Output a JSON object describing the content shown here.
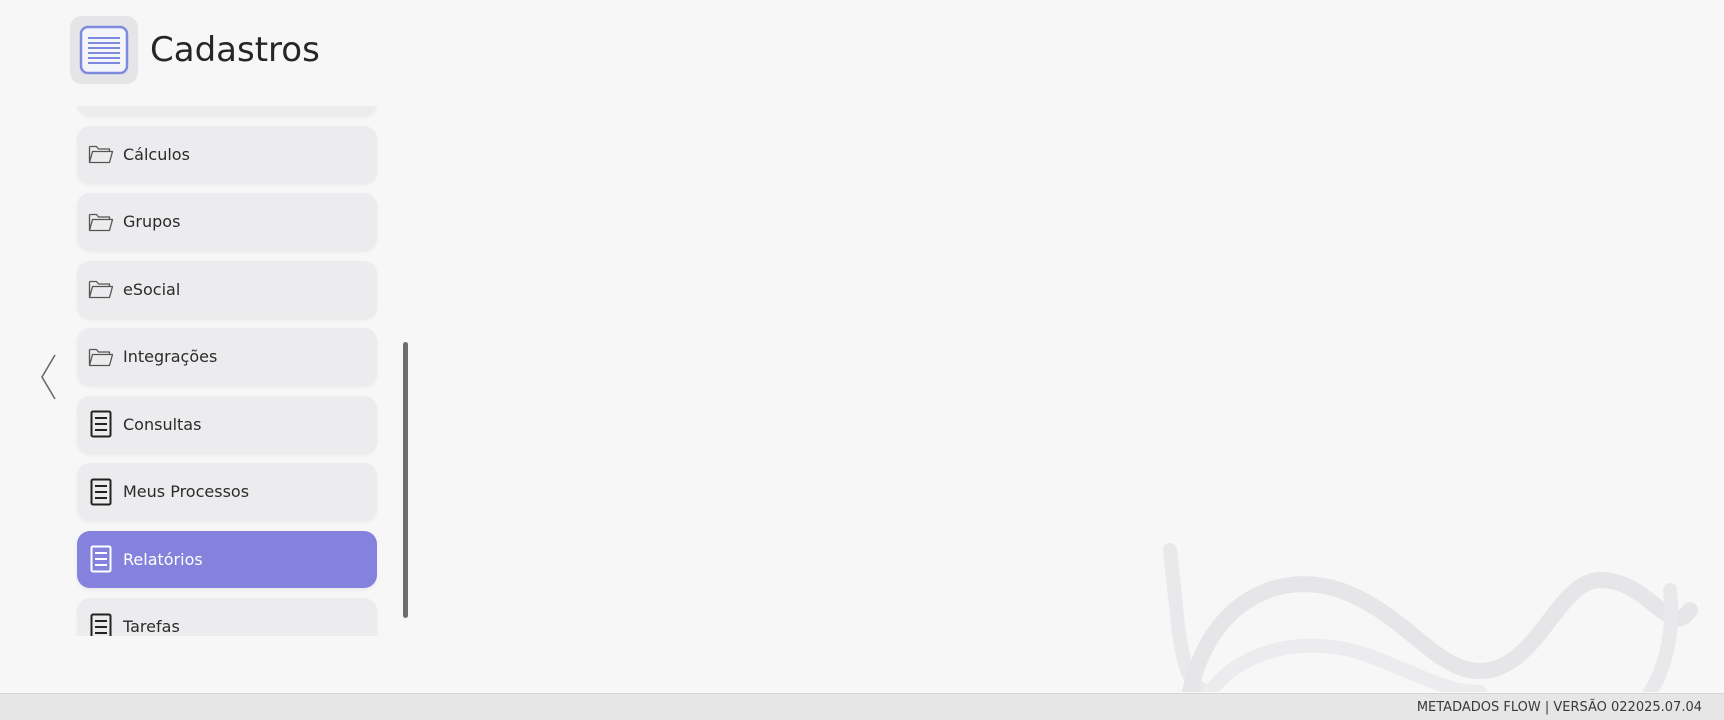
{
  "header": {
    "title": "Cadastros",
    "icon": "document-list-icon"
  },
  "navigation": {
    "back_icon": "chevron-left-icon"
  },
  "menu": {
    "items": [
      {
        "label": "",
        "icon": "folder-icon",
        "active": false
      },
      {
        "label": "Cálculos",
        "icon": "folder-icon",
        "active": false
      },
      {
        "label": "Grupos",
        "icon": "folder-icon",
        "active": false
      },
      {
        "label": "eSocial",
        "icon": "folder-icon",
        "active": false
      },
      {
        "label": "Integrações",
        "icon": "folder-icon",
        "active": false
      },
      {
        "label": "Consultas",
        "icon": "document-icon",
        "active": false
      },
      {
        "label": "Meus Processos",
        "icon": "document-icon",
        "active": false
      },
      {
        "label": "Relatórios",
        "icon": "document-icon",
        "active": true
      },
      {
        "label": "Tarefas",
        "icon": "document-icon",
        "active": false
      }
    ]
  },
  "footer": {
    "text": "METADADOS FLOW | VERSÃO 022025.07.04"
  },
  "colors": {
    "accent": "#8582dd",
    "item_bg": "#ececee",
    "page_bg": "#f7f7f8",
    "footer_bg": "#e6e6e6"
  }
}
